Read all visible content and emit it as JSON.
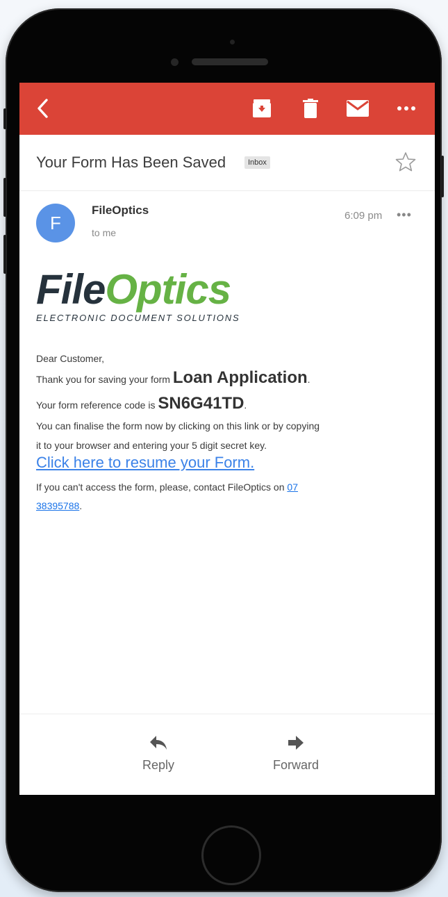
{
  "toolbar": {
    "back_icon": "chevron-left-icon",
    "archive_icon": "archive-icon",
    "delete_icon": "trash-icon",
    "mark_unread_icon": "mail-icon",
    "more_icon": "more-horizontal-icon",
    "bar_color": "#db4437"
  },
  "email": {
    "subject": "Your Form Has Been Saved",
    "label_badge": "Inbox",
    "sender_initial": "F",
    "sender_name": "FileOptics",
    "recipient": "to me",
    "time": "6:09 pm",
    "more_dots": "•••"
  },
  "body": {
    "logo_file": "File",
    "logo_optics": "Optics",
    "logo_tagline": "ELECTRONIC DOCUMENT SOLUTIONS",
    "greeting": "Dear Customer,",
    "line1_prefix": "Thank you for saving your form ",
    "form_name": "Loan Application",
    "line1_suffix": ".",
    "line2_prefix": "Your form reference code is ",
    "reference_code": "SN6G41TD",
    "line2_suffix": ".",
    "line3": "You can finalise the form now by clicking on this link or by copying",
    "line4": "it to your browser and entering your 5 digit secret key.",
    "resume_link": "Click here to resume your Form. ",
    "line5_prefix": "If you can't access the form, please, contact FileOptics on ",
    "phone_part1": "07",
    "phone_part2": "38395788",
    "line6_suffix": "."
  },
  "actions": {
    "reply_label": "Reply",
    "forward_label": "Forward"
  }
}
